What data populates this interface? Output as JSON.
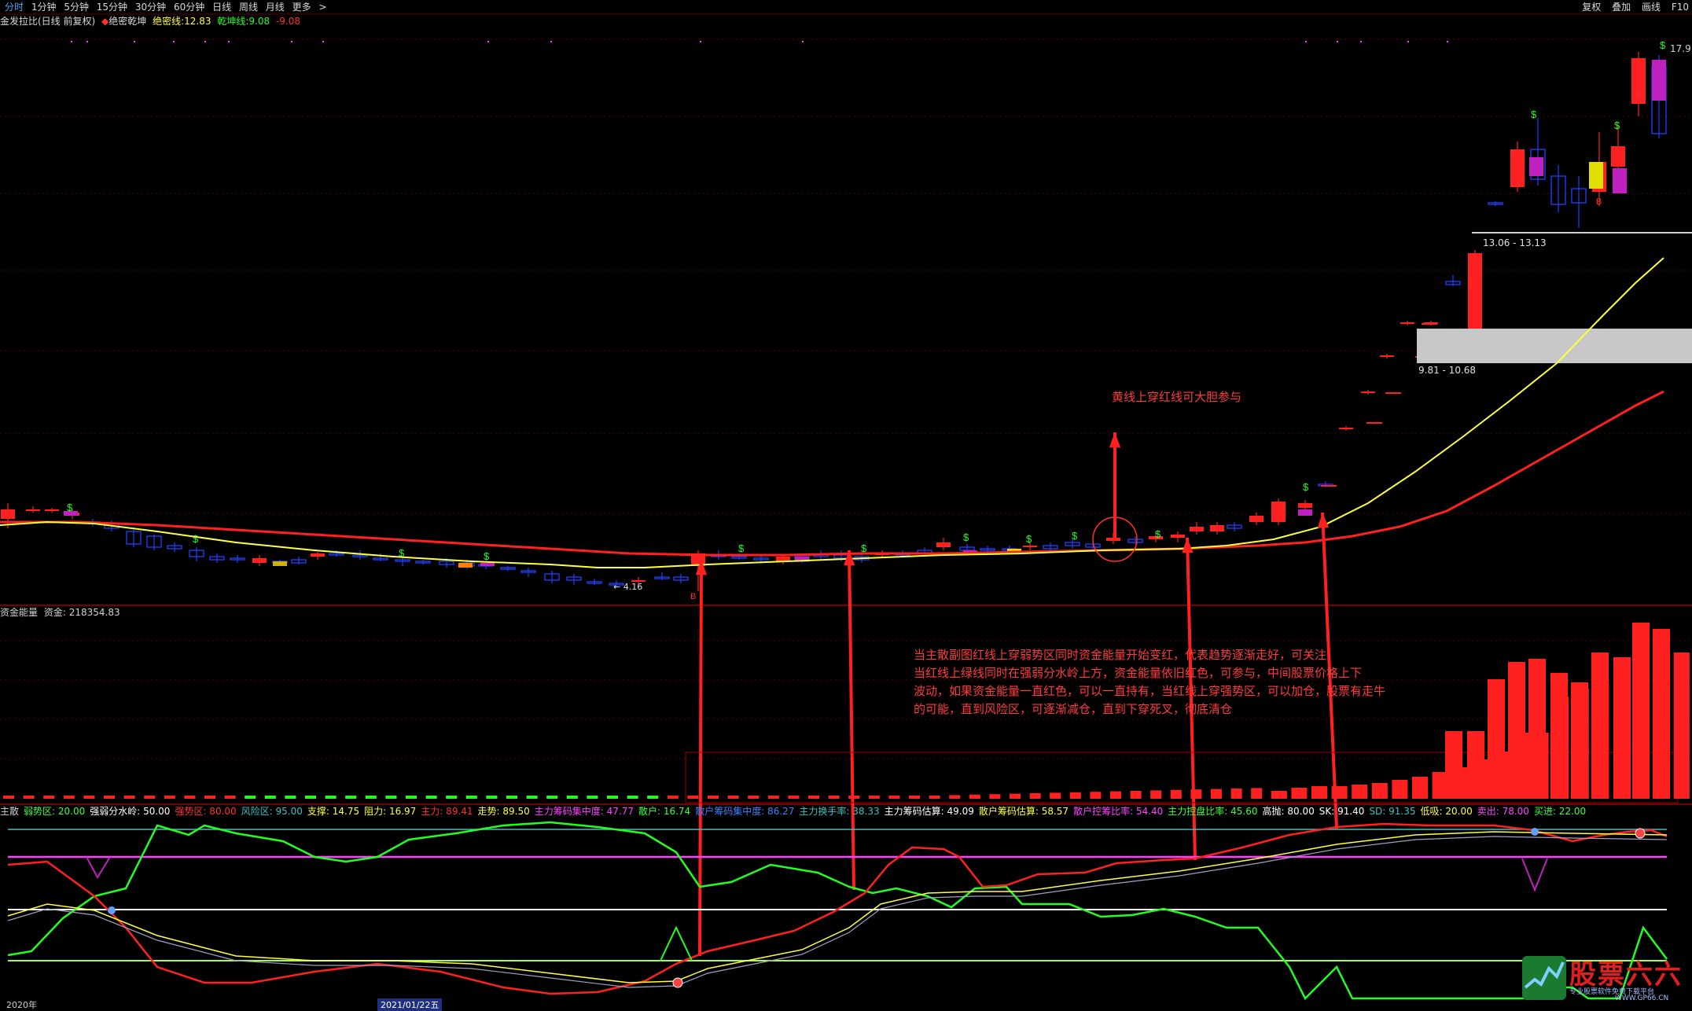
{
  "topbar": {
    "tabs": [
      "分时",
      "1分钟",
      "5分钟",
      "15分钟",
      "30分钟",
      "60分钟",
      "日线",
      "周线",
      "月线",
      "更多"
    ],
    "active": "分时",
    "more_chevron": ">",
    "right_buttons": [
      "复权",
      "叠加",
      "画线",
      "F10"
    ]
  },
  "title": {
    "stock": "金发拉比(日线 前复权)",
    "indicator": "绝密乾坤",
    "line1_label": "绝密线:",
    "line1_value": "12.83",
    "line2_label": "乾坤线:",
    "line2_value": "9.08",
    "line3_value": "-9.08"
  },
  "price_labels": {
    "top_right": "17.9",
    "zone_upper": "13.06 - 13.13",
    "zone_lower": "9.81 - 10.68",
    "low_marker": "← 4.16"
  },
  "annotations": {
    "main": "黄线上穿红线可大胆参与",
    "paragraph": [
      "当主散副图红线上穿弱势区同时资金能量开始变红，代表趋势逐渐走好，可关注",
      "当红线上绿线同时在强弱分水岭上方，资金能量依旧红色，可参与，中间股票价格上下",
      "波动，如果资金能量一直红色，可以一直持有，当红线上穿强势区，可以加仓，股票有走牛",
      "的可能，直到风险区，可逐渐减仓，直到下穿死叉，彻底清仓"
    ]
  },
  "fund": {
    "title": "资金能量",
    "label": "资金:",
    "value": "218354.83"
  },
  "indicator_row": [
    {
      "text": "主散",
      "color": "#d0d0d0"
    },
    {
      "text": "弱势区: 20.00",
      "color": "#3cff3c"
    },
    {
      "text": "强弱分水岭: 50.00",
      "color": "#ffffff"
    },
    {
      "text": "强势区: 80.00",
      "color": "#ff3030"
    },
    {
      "text": "风险区: 95.00",
      "color": "#40c0c0"
    },
    {
      "text": "支撑: 14.75",
      "color": "#ffff40"
    },
    {
      "text": "阻力: 16.97",
      "color": "#ffff40"
    },
    {
      "text": "主力: 89.41",
      "color": "#ff3030"
    },
    {
      "text": "走势: 89.50",
      "color": "#ffff40"
    },
    {
      "text": "主力筹码集中度: 47.77",
      "color": "#ff40ff"
    },
    {
      "text": "散户: 16.74",
      "color": "#3cff3c"
    },
    {
      "text": "散户筹码集中度: 86.27",
      "color": "#4080ff"
    },
    {
      "text": "主力换手率: 38.33",
      "color": "#40c0c0"
    },
    {
      "text": "主力筹码估算: 49.09",
      "color": "#ffffff"
    },
    {
      "text": "散户筹码估算: 58.57",
      "color": "#ffff40"
    },
    {
      "text": "散户控筹比率: 54.40",
      "color": "#ff40ff"
    },
    {
      "text": "主力控盘比率: 45.60",
      "color": "#3cff3c"
    },
    {
      "text": "高抛: 80.00",
      "color": "#ffffff"
    },
    {
      "text": "SK: 91.40",
      "color": "#ffffff"
    },
    {
      "text": "SD: 91.35",
      "color": "#40c0c0"
    },
    {
      "text": "低吸: 20.00",
      "color": "#ffff40"
    },
    {
      "text": "卖出: 78.00",
      "color": "#ff40ff"
    },
    {
      "text": "买进: 22.00",
      "color": "#3cff3c"
    }
  ],
  "bottom_dates": [
    "2020年",
    "2021/01/22五"
  ],
  "logo": {
    "text": "股票六六",
    "sub": "专业股票软件免费下载平台",
    "url": "WWW.GP66.CN"
  },
  "colors": {
    "up": "#ff2020",
    "down": "#2020ff",
    "yellow": "#ffff40",
    "green": "#20ff20",
    "magenta": "#ff40ff",
    "cyan": "#40c0c0"
  }
}
